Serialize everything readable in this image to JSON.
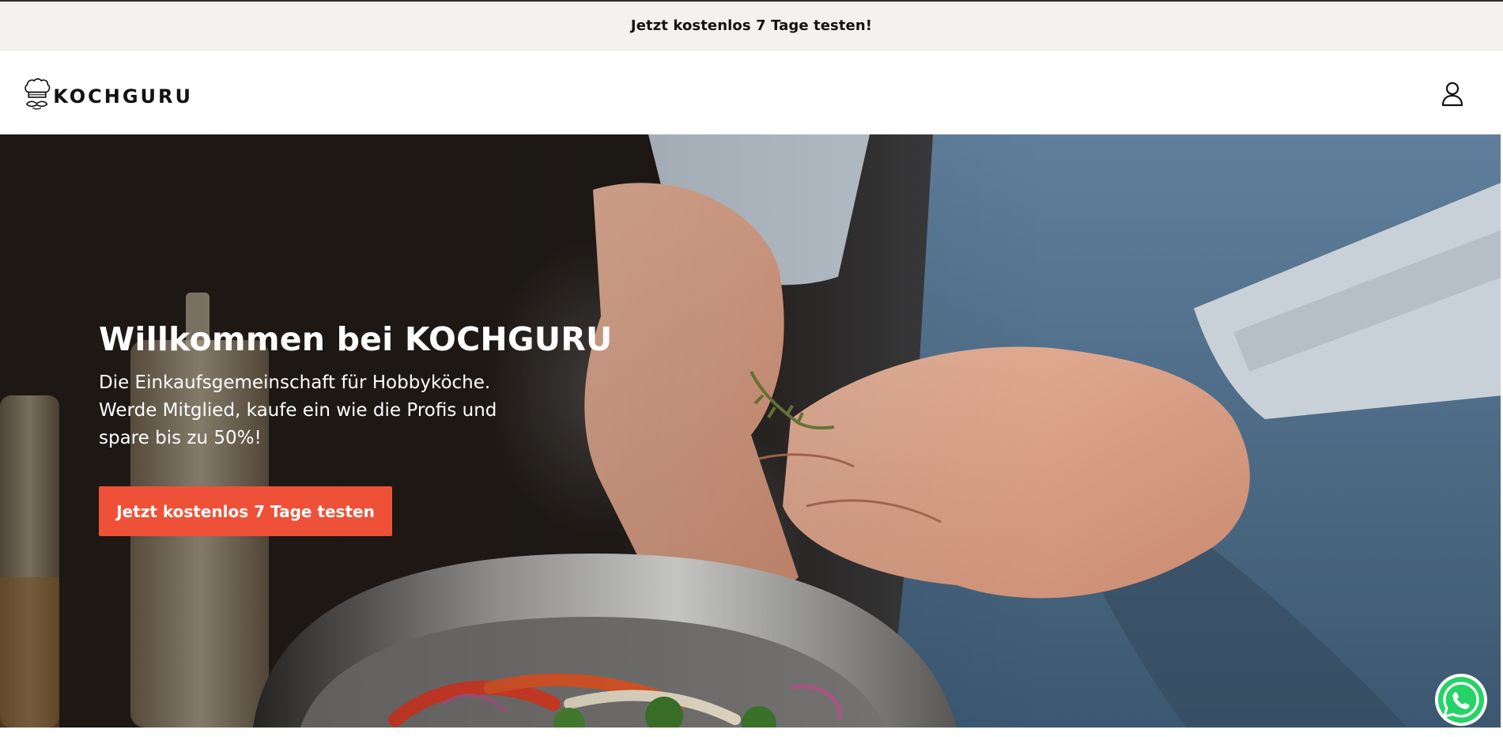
{
  "announcement": {
    "text": "Jetzt kostenlos 7 Tage testen!"
  },
  "header": {
    "logo_text": "KOCHGURU",
    "account_icon": "user-icon"
  },
  "hero": {
    "title": "Willkommen bei KOCHGURU",
    "lines": [
      "Die Einkaufsgemeinschaft für Hobbyköche.",
      "Werde Mitglied, kaufe ein wie die Profis und",
      "spare bis zu 50%!"
    ],
    "cta_label": "Jetzt kostenlos 7 Tage testen",
    "image": "chef-seasoning-pan-photo"
  },
  "floating": {
    "whatsapp_icon": "whatsapp-icon"
  },
  "colors": {
    "announcement_bg": "#f3f2ee",
    "cta_bg": "#ee5138",
    "whatsapp_green": "#25d366",
    "text_dark": "#121212"
  }
}
